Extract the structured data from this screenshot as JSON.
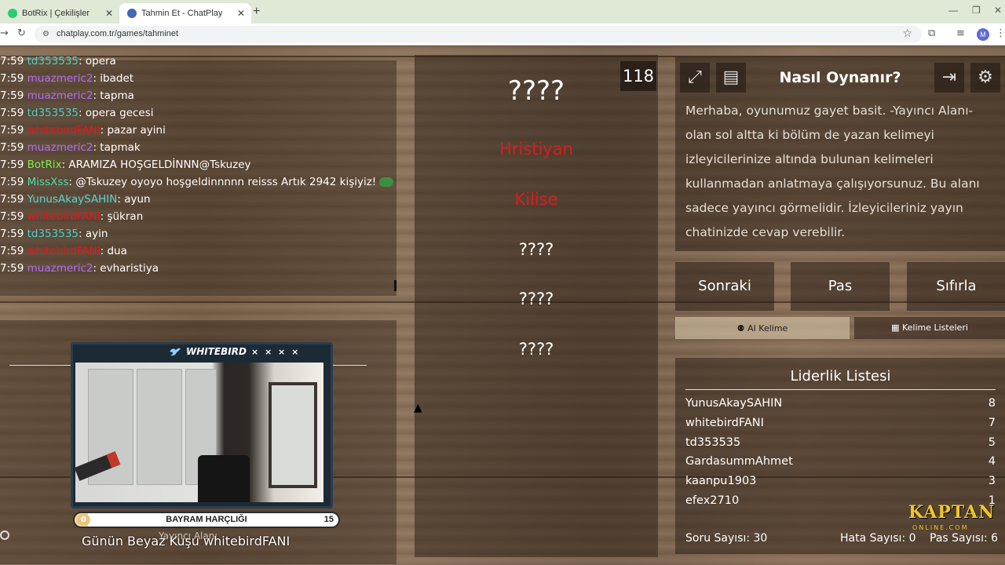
{
  "browser": {
    "tabs": [
      {
        "title": "BotRix | Çekilişler",
        "active": false
      },
      {
        "title": "Tahmin Et - ChatPlay",
        "active": true
      }
    ],
    "new_tab": "+",
    "url": "chatplay.com.tr/games/tahminet",
    "profile_initial": "M"
  },
  "chat": {
    "messages": [
      {
        "time": "7:59",
        "user": "td353535",
        "color": "#4dd0c8",
        "text": ": opera"
      },
      {
        "time": "7:59",
        "user": "muazmeric2",
        "color": "#b06cf0",
        "text": ": ibadet"
      },
      {
        "time": "7:59",
        "user": "muazmeric2",
        "color": "#b06cf0",
        "text": ": tapma"
      },
      {
        "time": "7:59",
        "user": "td353535",
        "color": "#4dd0c8",
        "text": ": opera gecesi"
      },
      {
        "time": "7:59",
        "user": "whitebirdFANI",
        "color": "#e0191f",
        "text": ": pazar ayini"
      },
      {
        "time": "7:59",
        "user": "muazmeric2",
        "color": "#b06cf0",
        "text": ": tapmak"
      },
      {
        "time": "7:59",
        "user": "BotRix",
        "color": "#7ff04a",
        "text": ": ARAMIZA HOŞGELDİNNN@Tskuzey"
      },
      {
        "time": "7:59",
        "user": "MissXss",
        "color": "#4ee0b0",
        "text": ": @Tskuzey oyoyo hoşgeldinnnnn reisss Artık 2942 kişiyiz!"
      },
      {
        "time": "7:59",
        "user": "YunusAkaySAHIN",
        "color": "#5ad2d2",
        "text": ": ayun"
      },
      {
        "time": "7:59",
        "user": "whitebirdFANI",
        "color": "#e0191f",
        "text": ": şükran"
      },
      {
        "time": "7:59",
        "user": "td353535",
        "color": "#4dd0c8",
        "text": ": ayin"
      },
      {
        "time": "7:59",
        "user": "whitebirdFANI",
        "color": "#e0191f",
        "text": ": dua"
      },
      {
        "time": "7:59",
        "user": "muazmeric2",
        "color": "#b06cf0",
        "text": ": evharistiya"
      }
    ]
  },
  "stream": {
    "cam_brand": "WHITEBIRD",
    "cam_dots": "× × × ×",
    "progress_start": "0",
    "progress_label": "BAYRAM HARÇLIĞI",
    "progress_end": "15",
    "progress_fraction": 0.05,
    "yayinci_label": "Yayıncı Alanı",
    "bird_of_day": "Günün Beyaz Kuşu whitebirdFANI"
  },
  "game": {
    "timer": "118",
    "target_word": "????",
    "forbidden_words": [
      "Hristiyan",
      "Kilise"
    ],
    "hidden_words": [
      "????",
      "????",
      "????"
    ]
  },
  "how_to": {
    "title": "Nasıl Oynanır?",
    "text": "Merhaba, oyunumuz gayet basit. -Yayıncı Alanı- olan sol altta ki bölüm de yazan kelimeyi izleyicilerinize altında bulunan kelimeleri kullanmadan anlatmaya çalışıyorsunuz. Bu alanı sadece yayıncı görmelidir. İzleyicileriniz yayın chatinizde cevap verebilir."
  },
  "actions": {
    "next": "Sonraki",
    "pass": "Pas",
    "reset": "Sıfırla",
    "ai_word": "AI Kelime",
    "word_lists": "Kelime Listeleri"
  },
  "leaderboard": {
    "title": "Liderlik Listesi",
    "rows": [
      {
        "name": "YunusAkaySAHIN",
        "score": "8"
      },
      {
        "name": "whitebirdFANI",
        "score": "7"
      },
      {
        "name": "td353535",
        "score": "5"
      },
      {
        "name": "GardasummAhmet",
        "score": "4"
      },
      {
        "name": "kaanpu1903",
        "score": "3"
      },
      {
        "name": "efex2710",
        "score": "1"
      }
    ]
  },
  "stats": {
    "questions": "Soru Sayısı: 30",
    "errors": "Hata Sayısı: 0",
    "passes": "Pas Sayısı: 6"
  },
  "brand": {
    "name": "KAPTAN",
    "sub": "ONLINE.COM",
    "color": "#f3c623"
  }
}
